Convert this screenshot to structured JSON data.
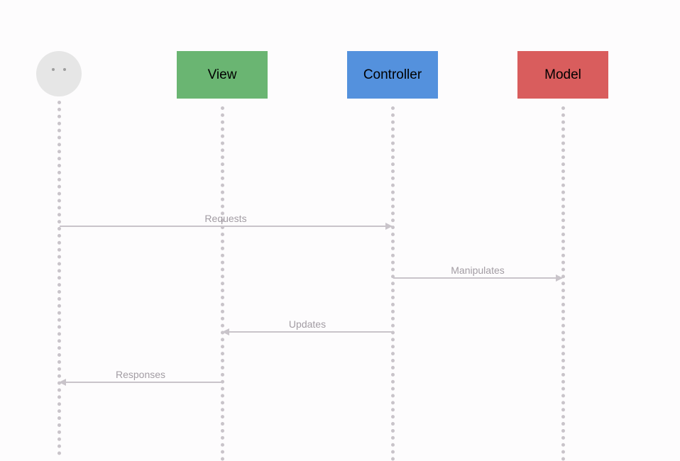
{
  "participants": {
    "user": {
      "label": ""
    },
    "view": {
      "label": "View",
      "color": "#6ab572"
    },
    "controller": {
      "label": "Controller",
      "color": "#5491dd"
    },
    "model": {
      "label": "Model",
      "color": "#d95d5d"
    }
  },
  "messages": {
    "requests": {
      "label": "Requests",
      "from": "user",
      "to": "controller"
    },
    "manipulates": {
      "label": "Manipulates",
      "from": "controller",
      "to": "model"
    },
    "updates": {
      "label": "Updates",
      "from": "controller",
      "to": "view"
    },
    "responses": {
      "label": "Responses",
      "from": "view",
      "to": "user"
    }
  }
}
